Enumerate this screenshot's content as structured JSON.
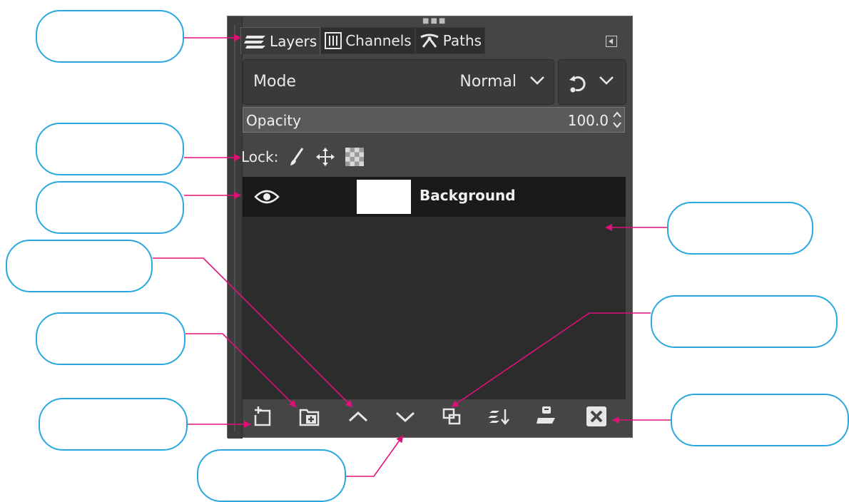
{
  "tabs": [
    {
      "label": "Layers",
      "icon": "layers-icon",
      "active": true
    },
    {
      "label": "Channels",
      "icon": "channels-icon",
      "active": false
    },
    {
      "label": "Paths",
      "icon": "paths-icon",
      "active": false
    }
  ],
  "mode": {
    "label": "Mode",
    "value": "Normal"
  },
  "opacity": {
    "label": "Opacity",
    "value": "100.0"
  },
  "lock": {
    "label": "Lock:",
    "icons": [
      "brush-icon",
      "move-icon",
      "alpha-checker-icon"
    ]
  },
  "layers": [
    {
      "name": "Background",
      "visible": true,
      "thumbnail_color": "#ffffff"
    }
  ],
  "bottom_buttons": [
    "new-layer-icon",
    "new-layer-group-icon",
    "raise-layer-icon",
    "lower-layer-icon",
    "duplicate-layer-icon",
    "merge-down-icon",
    "anchor-layer-icon",
    "delete-layer-icon"
  ],
  "callouts": [
    {
      "text": ""
    },
    {
      "text": ""
    },
    {
      "text": ""
    },
    {
      "text": ""
    },
    {
      "text": ""
    },
    {
      "text": ""
    },
    {
      "text": ""
    },
    {
      "text": ""
    },
    {
      "text": ""
    },
    {
      "text": ""
    }
  ],
  "colors": {
    "panel_bg": "#454545",
    "list_bg": "#2c2c2c",
    "selected_row": "#1a1a1a",
    "callout_border": "#29a8e0",
    "connector": "#e0107a"
  }
}
